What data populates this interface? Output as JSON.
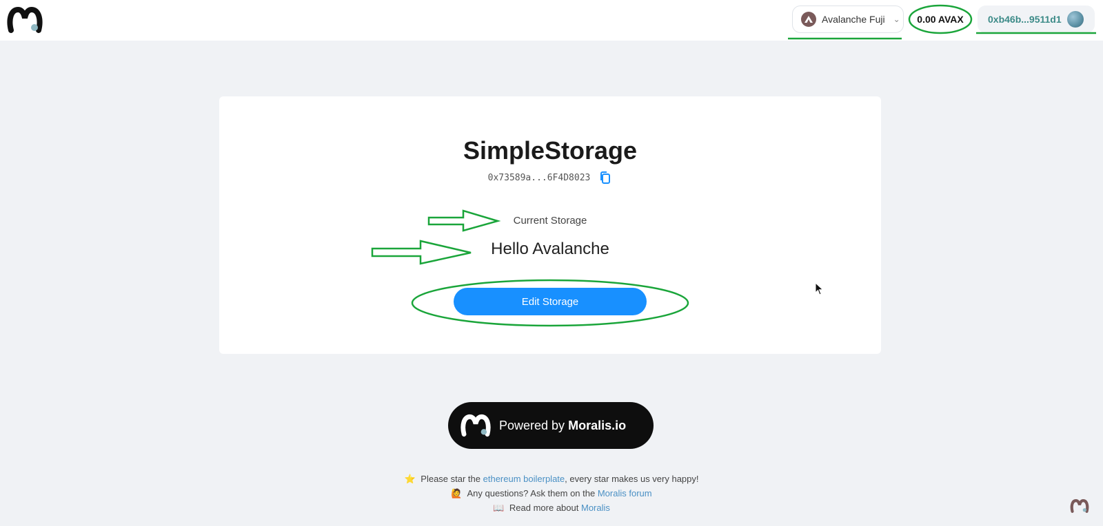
{
  "header": {
    "logo_icon": "moralis-logo-icon",
    "network": {
      "label": "Avalanche Fuji",
      "icon": "avalanche-icon",
      "chevron": "chevron-down-icon"
    },
    "balance": "0.00 AVAX",
    "account": {
      "address": "0xb46b...9511d1",
      "avatar": "avatar-icon"
    }
  },
  "contract": {
    "name": "SimpleStorage",
    "address": "0x73589a...6F4D8023",
    "copy_icon": "copy-icon",
    "storage_label": "Current Storage",
    "storage_value": "Hello Avalanche",
    "edit_button": "Edit Storage"
  },
  "powered_by": {
    "prefix": "Powered by",
    "brand": "Moralis.io"
  },
  "footer": {
    "line1": {
      "emoji": "⭐",
      "pre": "Please star the",
      "link": "ethereum boilerplate",
      "post": ", every star makes us very happy!"
    },
    "line2": {
      "emoji": "🙋",
      "pre": "Any questions? Ask them on the",
      "link": "Moralis forum"
    },
    "line3": {
      "emoji": "📖",
      "pre": "Read more about",
      "link": "Moralis"
    }
  },
  "colors": {
    "accent": "#1890ff",
    "annotation": "#1aa53a",
    "account_text": "#3b8a87",
    "link": "#4a90c4",
    "background": "#f0f2f5"
  }
}
